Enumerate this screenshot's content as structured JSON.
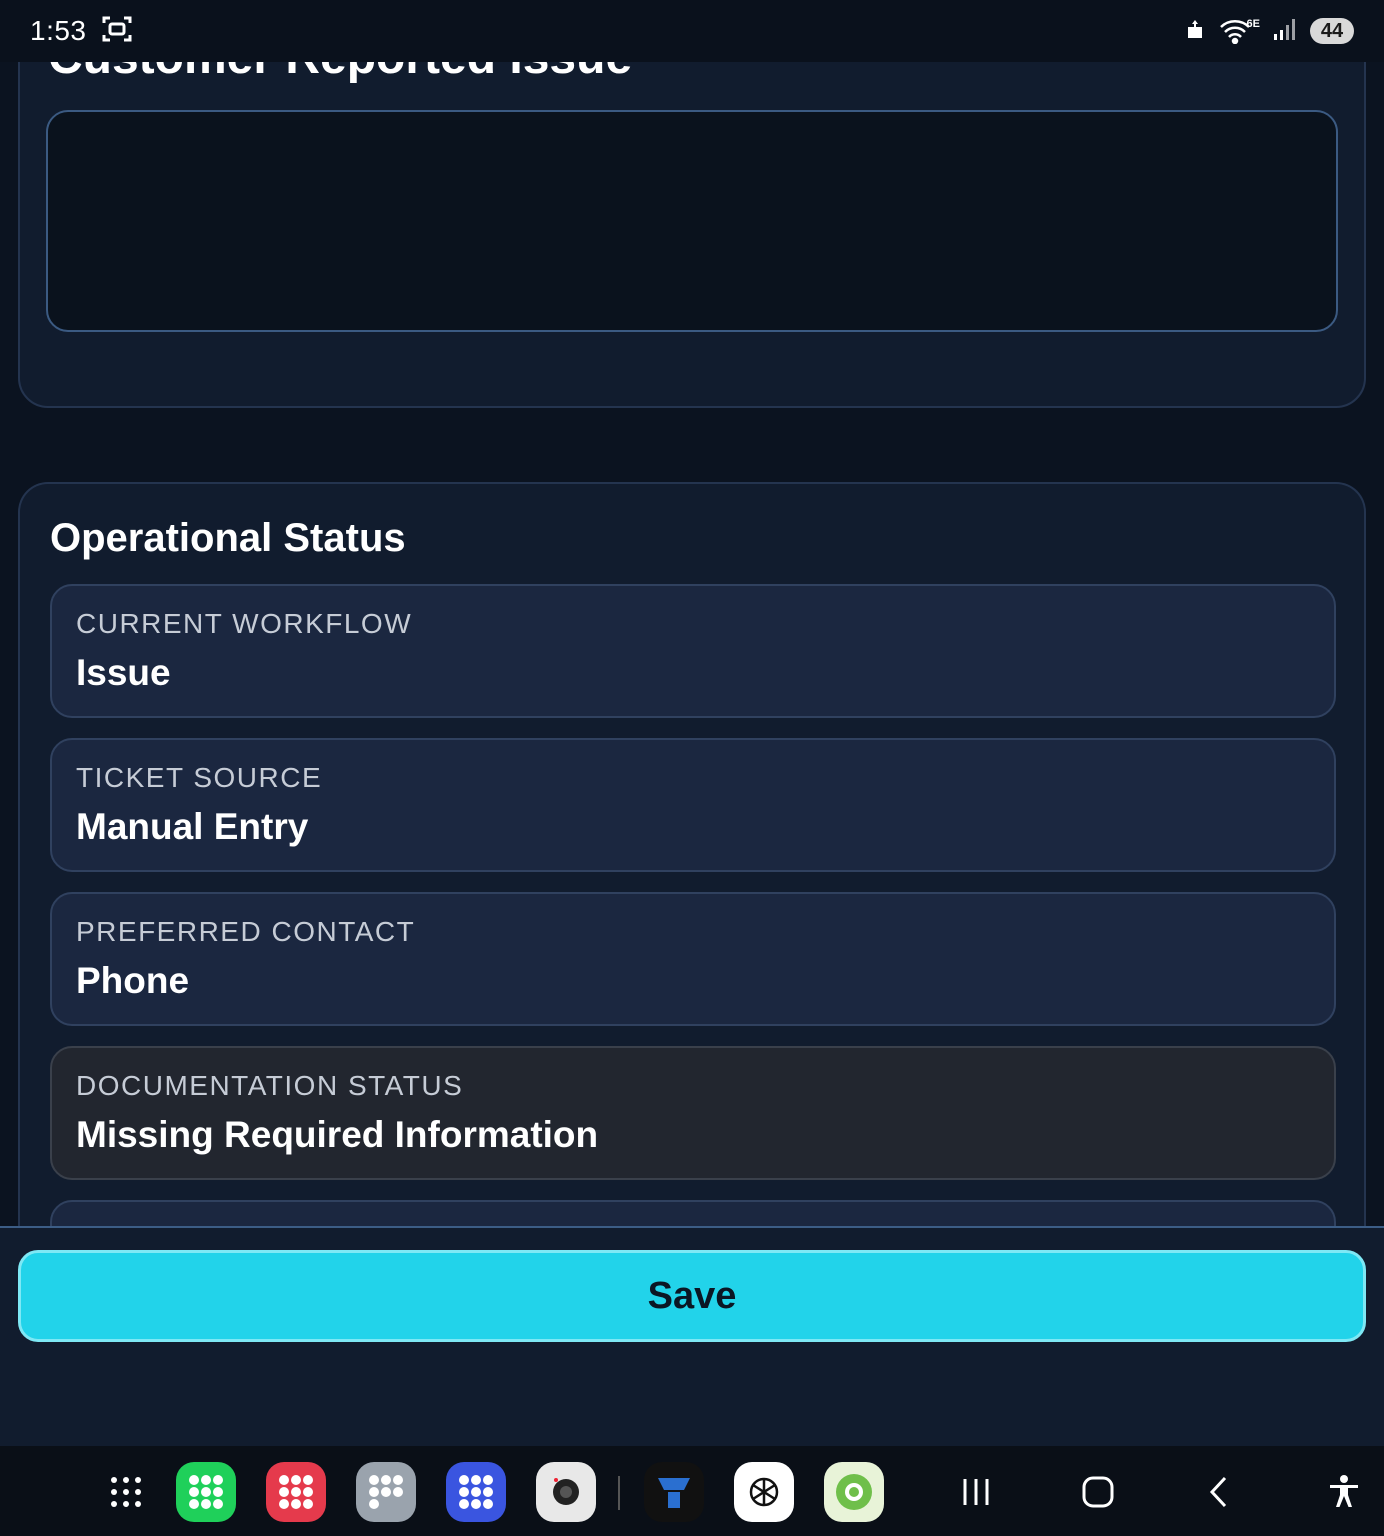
{
  "status_bar": {
    "time": "1:53",
    "network_label": "6E",
    "battery": "44"
  },
  "issue_card": {
    "title": "Customer Reported Issue",
    "textarea_value": ""
  },
  "operational_status": {
    "title": "Operational Status",
    "fields": [
      {
        "label": "CURRENT WORKFLOW",
        "value": "Issue"
      },
      {
        "label": "TICKET SOURCE",
        "value": "Manual Entry"
      },
      {
        "label": "PREFERRED CONTACT",
        "value": "Phone"
      },
      {
        "label": "DOCUMENTATION STATUS",
        "value": "Missing Required Information"
      }
    ]
  },
  "save": {
    "label": "Save"
  },
  "dock": {
    "apps": [
      "app-drawer-icon",
      "folder-green-icon",
      "folder-red-icon",
      "folder-gray-icon",
      "folder-blue-icon",
      "camera-icon",
      "tf-app-icon",
      "chatgpt-icon",
      "android-app-icon"
    ]
  },
  "colors": {
    "background": "#0b1320",
    "card": "#111c2e",
    "field": "#1b2740",
    "accent": "#22d3ea"
  }
}
